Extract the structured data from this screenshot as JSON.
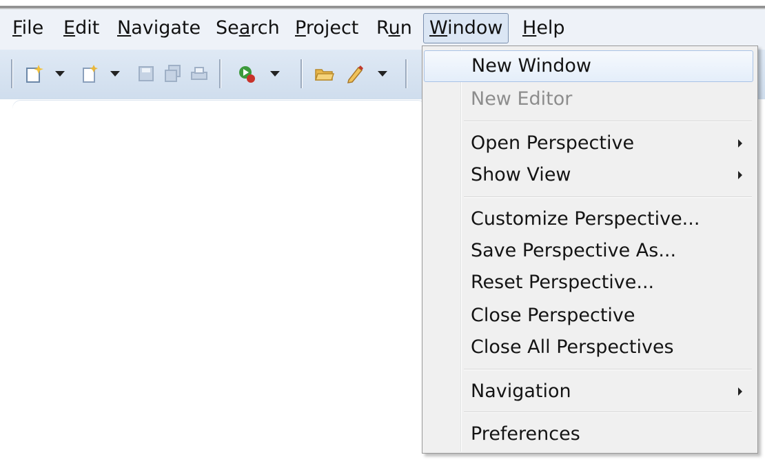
{
  "menubar": {
    "items": [
      {
        "label": "File",
        "mnemonic": "F",
        "rest": "ile"
      },
      {
        "label": "Edit",
        "mnemonic": "E",
        "rest": "dit"
      },
      {
        "label": "Navigate",
        "mnemonic": "N",
        "rest": "avigate"
      },
      {
        "label": "Search",
        "pre": "Se",
        "mnemonic": "a",
        "rest": "rch"
      },
      {
        "label": "Project",
        "mnemonic": "P",
        "rest": "roject"
      },
      {
        "label": "Run",
        "pre": "R",
        "mnemonic": "u",
        "rest": "n"
      },
      {
        "label": "Window",
        "mnemonic": "W",
        "rest": "indow"
      },
      {
        "label": "Help",
        "mnemonic": "H",
        "rest": "elp"
      }
    ]
  },
  "toolbar": {
    "icons": [
      "new-wizard-icon",
      "new-file-icon",
      "save-icon",
      "save-all-icon",
      "print-icon",
      "run-icon",
      "open-folder-icon",
      "pencil-icon"
    ]
  },
  "window_menu": {
    "items": [
      {
        "label": "New Window"
      },
      {
        "label": "New Editor"
      },
      {
        "label": "Open Perspective"
      },
      {
        "label": "Show View"
      },
      {
        "label": "Customize Perspective..."
      },
      {
        "label": "Save Perspective As..."
      },
      {
        "label": "Reset Perspective..."
      },
      {
        "label": "Close Perspective"
      },
      {
        "label": "Close All Perspectives"
      },
      {
        "label": "Navigation"
      },
      {
        "label": "Preferences"
      }
    ]
  },
  "colors": {
    "menubar_bg": "#eef2f8",
    "toolbar_bg": "#d7e3f1",
    "menu_bg": "#f0f0f0",
    "hover_border": "#a8c2e6",
    "disabled_text": "#8d8d8d"
  }
}
